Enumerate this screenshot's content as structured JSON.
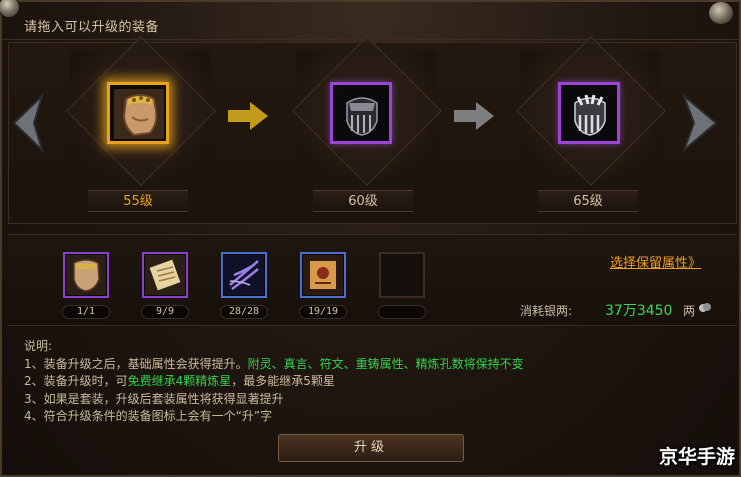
{
  "window": {
    "title": "请拖入可以升级的装备",
    "close_icon": "close-icon"
  },
  "upgrade_chain": [
    {
      "level_label": "55级",
      "frame_color": "#e9a21a",
      "icon": "gauntlet-gold-icon"
    },
    {
      "level_label": "60级",
      "frame_color": "#9a45d8",
      "icon": "gauntlet-dark-icon"
    },
    {
      "level_label": "65级",
      "frame_color": "#9a45d8",
      "icon": "gauntlet-silver-icon"
    }
  ],
  "materials": [
    {
      "count": "1/1",
      "icon": "gauntlet-icon",
      "frame": "purple"
    },
    {
      "count": "9/9",
      "icon": "scroll-icon",
      "frame": "purple"
    },
    {
      "count": "28/28",
      "icon": "feather-icon",
      "frame": "blue"
    },
    {
      "count": "19/19",
      "icon": "rune-scroll-icon",
      "frame": "blue"
    },
    {
      "count": "",
      "icon": "empty-slot",
      "frame": "empty"
    }
  ],
  "retain": {
    "link_label": "选择保留属性》"
  },
  "cost": {
    "label": "消耗银两:",
    "value": "37万3450",
    "unit": "两"
  },
  "description": {
    "heading": "说明:",
    "line1_prefix": "1、装备升级之后，基础属性会获得提升。",
    "line1_highlight": "附灵、真言、符文、重铸属性、精炼孔数将保持不变",
    "line2_prefix": "2、装备升级时，可",
    "line2_highlight": "免费继承4颗精炼星",
    "line2_suffix": "，最多能继承5颗星",
    "line3": "3、如果是套装，升级后套装属性将获得显著提升",
    "line4": "4、符合升级条件的装备图标上会有一个“升”字"
  },
  "upgrade_button": {
    "label": "升级"
  },
  "watermark": "京华手游",
  "colors": {
    "highlight_green": "#35d24d",
    "link_orange": "#f0a020",
    "cost_green": "#38d85a"
  }
}
